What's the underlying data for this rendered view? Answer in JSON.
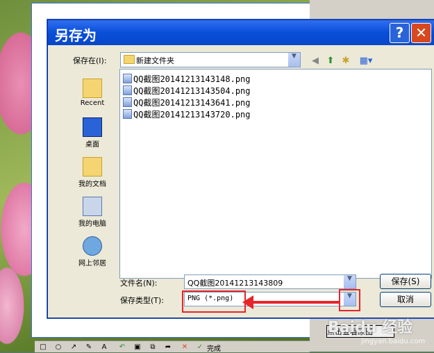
{
  "dialog": {
    "title": "另存为",
    "help": "?",
    "close": "✕",
    "save_in_label": "保存在(I):",
    "save_in_value": "新建文件夹",
    "places": [
      {
        "label": "Recent",
        "icon": "recent-folder-icon"
      },
      {
        "label": "桌面",
        "icon": "desktop-icon"
      },
      {
        "label": "我的文档",
        "icon": "my-documents-icon"
      },
      {
        "label": "我的电脑",
        "icon": "my-computer-icon"
      },
      {
        "label": "网上邻居",
        "icon": "network-icon"
      }
    ],
    "files": [
      "QQ截图20141213143148.png",
      "QQ截图20141213143504.png",
      "QQ截图20141213143641.png",
      "QQ截图20141213143720.png"
    ],
    "filename_label": "文件名(N):",
    "filename_value": "QQ截图20141213143809",
    "filetype_label": "保存类型(T):",
    "filetype_value": "PNG (*.png)",
    "save_button": "保存(S)",
    "cancel_button": "取消"
  },
  "overlay": {
    "bottom_note": "点击查看原图",
    "watermark": "Baidu 经验",
    "watermark_sub": "jingyan.baidu.com",
    "toolbar_done": "完成"
  },
  "colors": {
    "titlebar": "#0a4fd9",
    "highlight": "#e5252a",
    "close_button": "#d8481f"
  }
}
